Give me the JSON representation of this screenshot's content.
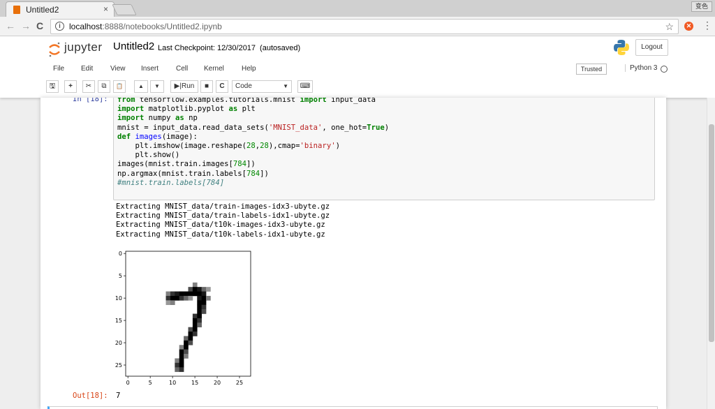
{
  "browser": {
    "tab_title": "Untitled2",
    "tab_close": "×",
    "window_button": "变色",
    "url_host": "localhost",
    "url_rest": ":8888/notebooks/Untitled2.ipynb",
    "back": "←",
    "forward": "→",
    "reload": "C",
    "bookmark": "☆"
  },
  "header": {
    "logo_text": "jupyter",
    "notebook_name": "Untitled2",
    "checkpoint": "Last Checkpoint: 12/30/2017",
    "autosave": "(autosaved)",
    "logout": "Logout"
  },
  "menu": {
    "items": [
      "File",
      "Edit",
      "View",
      "Insert",
      "Cell",
      "Kernel",
      "Help"
    ],
    "trusted": "Trusted",
    "kernel": "Python 3"
  },
  "toolbar": {
    "save": "🖫",
    "add": "+",
    "cut": "✂",
    "copy": "⧉",
    "paste": "📋",
    "up": "▲",
    "down": "▼",
    "run": "Run",
    "stop": "■",
    "restart": "C",
    "cell_type": "Code",
    "keyboard": "⌨"
  },
  "cell": {
    "in_prompt": "In [18]:",
    "code_lines": [
      "from tensorflow.examples.tutorials.mnist import input_data",
      "import matplotlib.pyplot as plt",
      "import numpy as np",
      "mnist = input_data.read_data_sets('MNIST_data', one_hot=True)",
      "def images(image):",
      "    plt.imshow(image.reshape(28,28),cmap='binary')",
      "    plt.show()",
      "images(mnist.train.images[784])",
      "np.argmax(mnist.train.labels[784])",
      "#mnist.train.labels[784]"
    ],
    "stream_output": "Extracting MNIST_data/train-images-idx3-ubyte.gz\nExtracting MNIST_data/train-labels-idx1-ubyte.gz\nExtracting MNIST_data/t10k-images-idx3-ubyte.gz\nExtracting MNIST_data/t10k-labels-idx1-ubyte.gz",
    "out_prompt": "Out[18]:",
    "out_value": "7"
  },
  "chart_data": {
    "type": "heatmap",
    "title": "",
    "xlabel": "",
    "ylabel": "",
    "xlim": [
      -0.5,
      27.5
    ],
    "ylim": [
      27.5,
      -0.5
    ],
    "xticks": [
      0,
      5,
      10,
      15,
      20,
      25
    ],
    "yticks": [
      0,
      5,
      10,
      15,
      20,
      25
    ],
    "colormap": "binary",
    "pixels": [
      [
        7,
        15,
        0.5
      ],
      [
        8,
        14,
        0.7
      ],
      [
        8,
        15,
        1
      ],
      [
        8,
        16,
        0.9
      ],
      [
        8,
        17,
        0.6
      ],
      [
        8,
        18,
        0.4
      ],
      [
        9,
        9,
        0.5
      ],
      [
        9,
        10,
        0.8
      ],
      [
        9,
        11,
        0.9
      ],
      [
        9,
        12,
        1
      ],
      [
        9,
        13,
        1
      ],
      [
        9,
        14,
        1
      ],
      [
        9,
        15,
        1
      ],
      [
        9,
        16,
        1
      ],
      [
        9,
        17,
        0.9
      ],
      [
        10,
        9,
        0.8
      ],
      [
        10,
        10,
        1
      ],
      [
        10,
        11,
        1
      ],
      [
        10,
        12,
        0.8
      ],
      [
        10,
        13,
        0.6
      ],
      [
        10,
        14,
        0.4
      ],
      [
        10,
        16,
        0.9
      ],
      [
        10,
        17,
        1
      ],
      [
        10,
        18,
        0.5
      ],
      [
        11,
        9,
        0.4
      ],
      [
        11,
        10,
        0.5
      ],
      [
        11,
        16,
        1
      ],
      [
        11,
        17,
        1
      ],
      [
        12,
        16,
        1
      ],
      [
        12,
        17,
        0.8
      ],
      [
        13,
        16,
        1
      ],
      [
        13,
        17,
        0.7
      ],
      [
        14,
        15,
        0.8
      ],
      [
        14,
        16,
        1
      ],
      [
        15,
        15,
        1
      ],
      [
        15,
        16,
        0.8
      ],
      [
        16,
        15,
        1
      ],
      [
        16,
        16,
        0.6
      ],
      [
        17,
        14,
        0.7
      ],
      [
        17,
        15,
        1
      ],
      [
        18,
        14,
        1
      ],
      [
        18,
        15,
        0.8
      ],
      [
        19,
        13,
        0.6
      ],
      [
        19,
        14,
        1
      ],
      [
        20,
        13,
        1
      ],
      [
        20,
        14,
        0.7
      ],
      [
        21,
        12,
        0.5
      ],
      [
        21,
        13,
        1
      ],
      [
        22,
        12,
        1
      ],
      [
        22,
        13,
        0.7
      ],
      [
        23,
        12,
        1
      ],
      [
        23,
        13,
        0.5
      ],
      [
        24,
        11,
        0.5
      ],
      [
        24,
        12,
        1
      ],
      [
        25,
        11,
        0.8
      ],
      [
        25,
        12,
        1
      ],
      [
        26,
        11,
        0.6
      ],
      [
        26,
        12,
        0.8
      ]
    ]
  }
}
